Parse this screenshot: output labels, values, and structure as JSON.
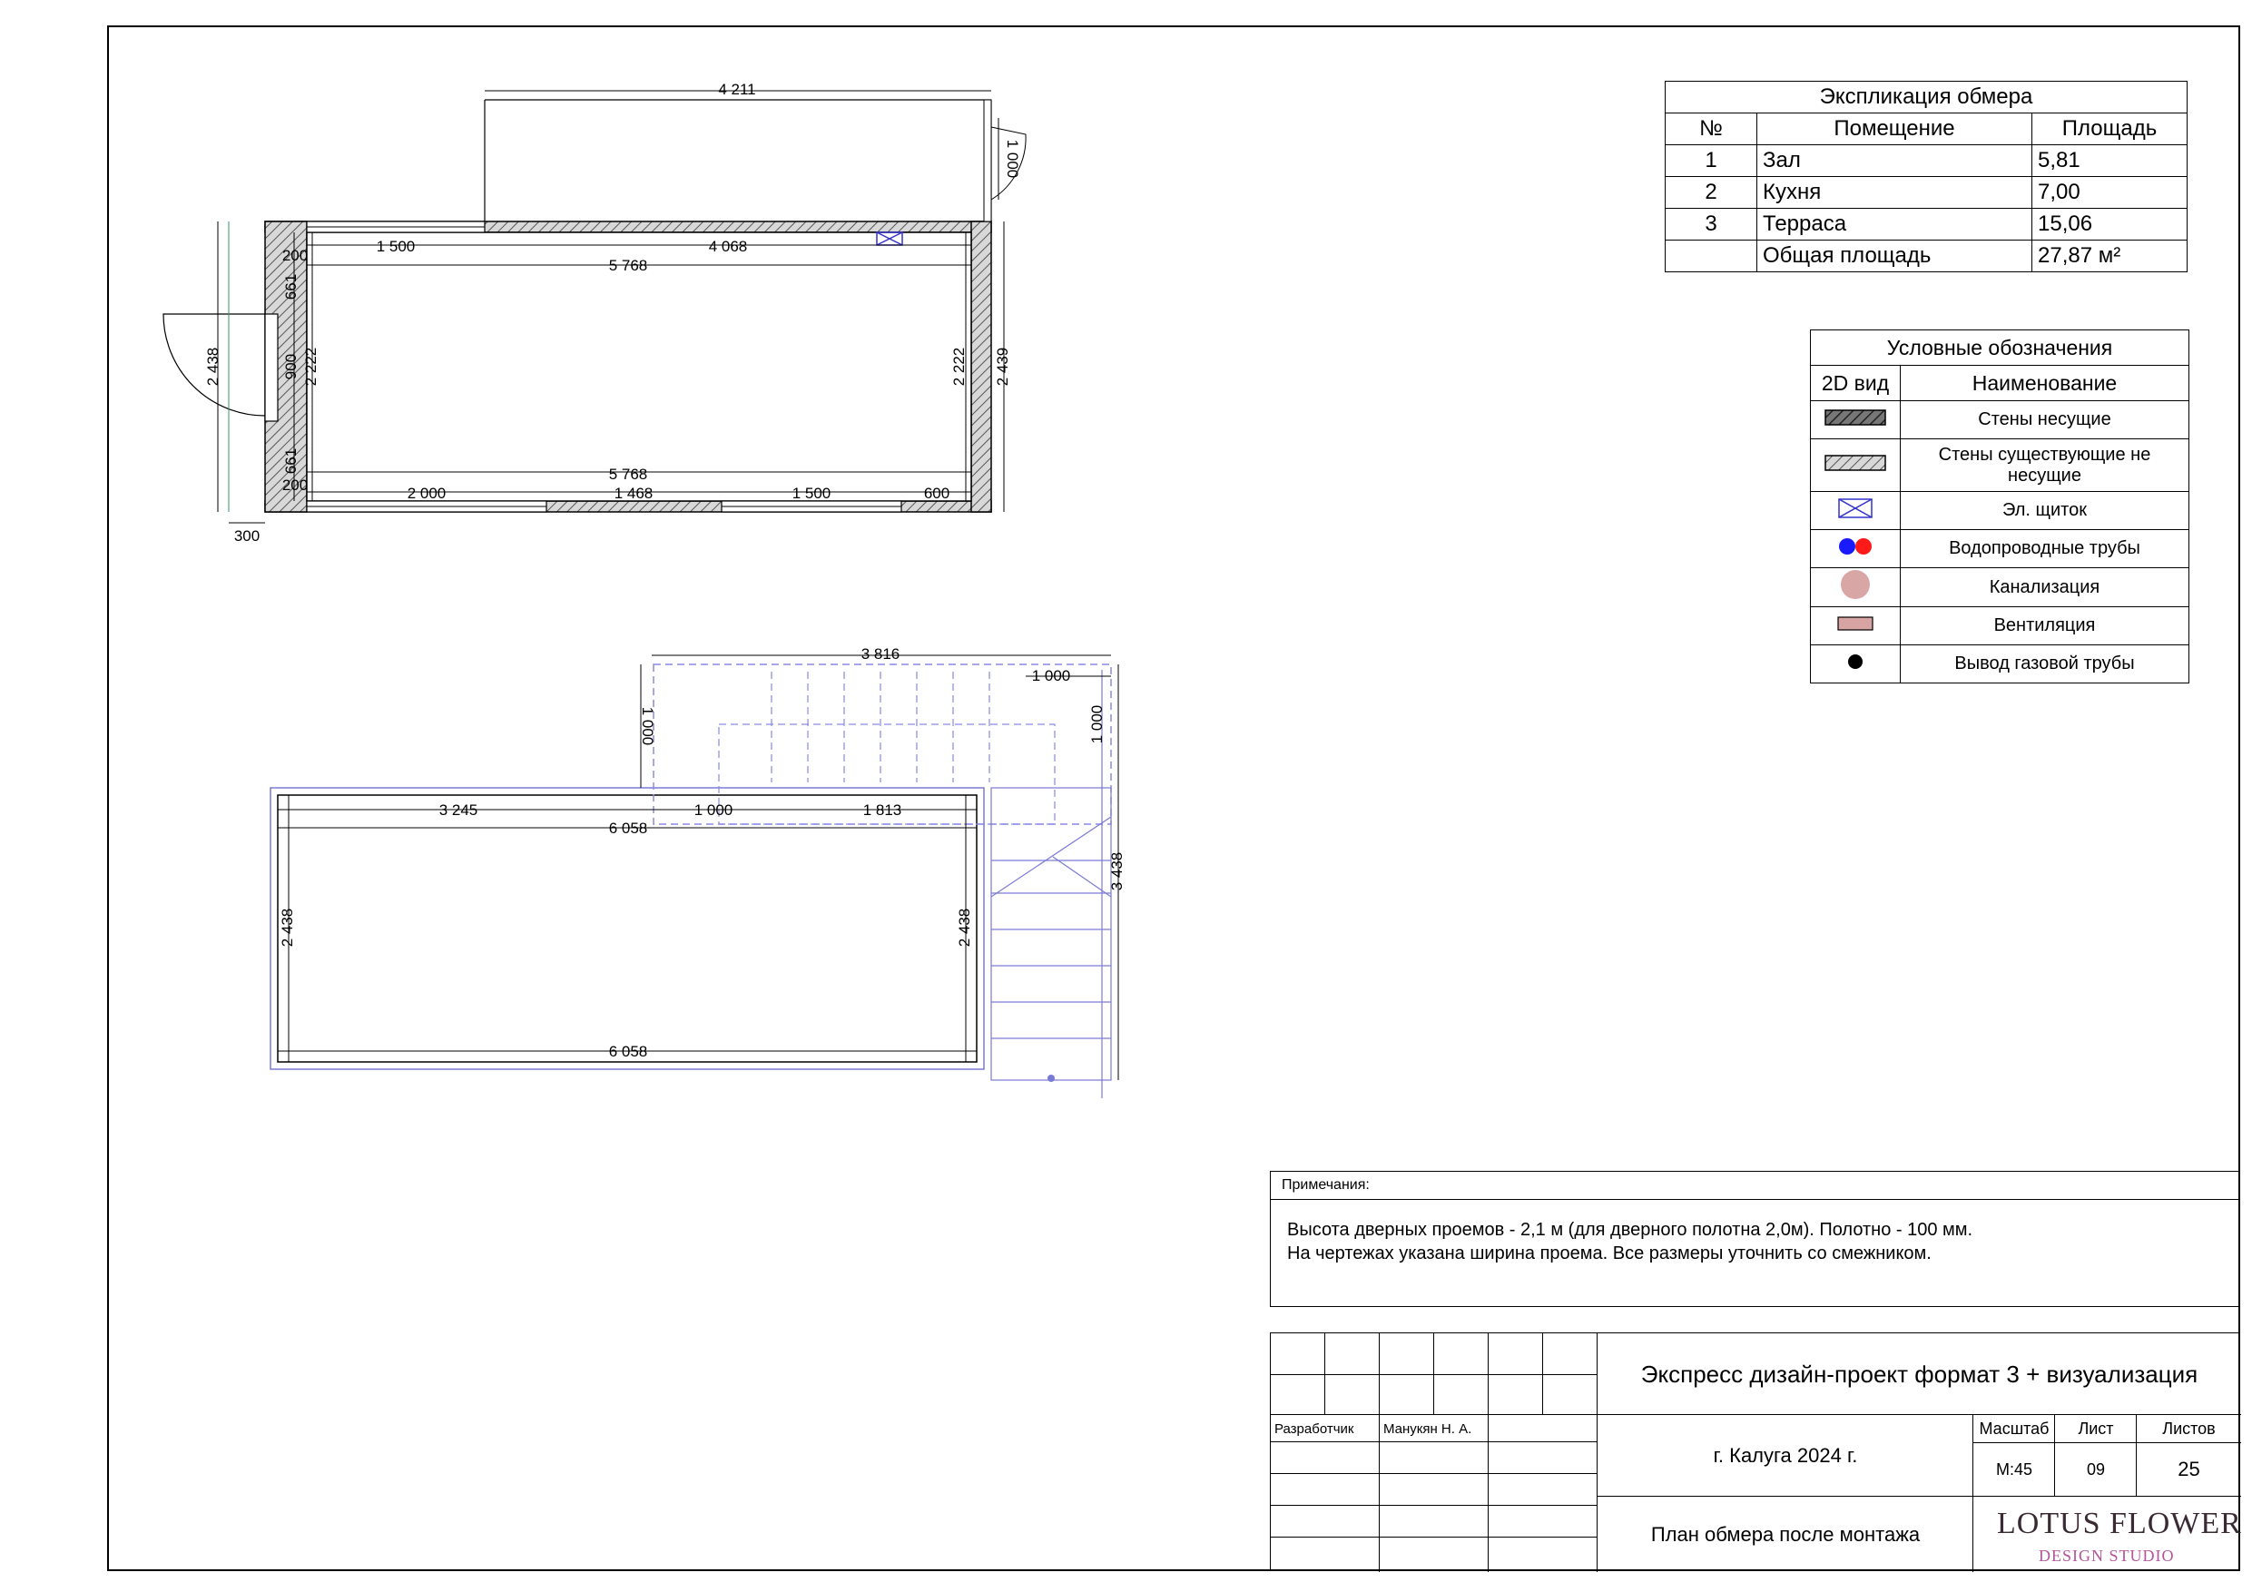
{
  "explication": {
    "title": "Экспликация обмера",
    "headers": [
      "№",
      "Помещение",
      "Площадь"
    ],
    "rows": [
      {
        "num": "1",
        "room": "Зал",
        "area": "5,81"
      },
      {
        "num": "2",
        "room": "Кухня",
        "area": "7,00"
      },
      {
        "num": "3",
        "room": "Терраса",
        "area": "15,06"
      }
    ],
    "total_label": "Общая площадь",
    "total_value": "27,87 м²"
  },
  "legend": {
    "title": "Условные обозначения",
    "col1": "2D вид",
    "col2": "Наименование",
    "items": [
      {
        "icon": "load-bearing-wall-icon",
        "label": "Стены несущие"
      },
      {
        "icon": "non-load-bearing-wall-icon",
        "label": "Стены существующие не несущие"
      },
      {
        "icon": "electrical-panel-icon",
        "label": "Эл. щиток"
      },
      {
        "icon": "water-pipes-icon",
        "label": "Водопроводные трубы"
      },
      {
        "icon": "sewer-icon",
        "label": "Канализация"
      },
      {
        "icon": "ventilation-icon",
        "label": "Вентиляция"
      },
      {
        "icon": "gas-pipe-icon",
        "label": "Вывод газовой трубы"
      }
    ],
    "colors": {
      "water_blue": "#1a1aff",
      "water_red": "#ff1a1a",
      "sewer": "#d9a6a6",
      "vent": "#d7a3a3"
    }
  },
  "plan1_dims": {
    "d4211": "4 211",
    "d1000": "1 000",
    "d1500a": "1 500",
    "d4068": "4 068",
    "d200a": "200",
    "d5768a": "5 768",
    "d661a": "661",
    "d900": "900",
    "d2222a": "2 222",
    "d2438": "2 438",
    "d2222b": "2 222",
    "d2439": "2 439",
    "d661b": "661",
    "d5768b": "5 768",
    "d200b": "200",
    "d2000": "2 000",
    "d1468": "1 468",
    "d1500b": "1 500",
    "d600": "600",
    "d300": "300"
  },
  "plan2_dims": {
    "d3816": "3 816",
    "d1000a": "1 000",
    "d1000b": "1 000",
    "d1000c": "1 000",
    "d1000d": "1 000",
    "d3245": "3 245",
    "d1813": "1 813",
    "d6058a": "6 058",
    "d2438a": "2 438",
    "d2438b": "2 438",
    "d3438": "3 438",
    "d6058b": "6 058"
  },
  "notes": {
    "header": "Примечания:",
    "line1": "Высота дверных проемов - 2,1 м (для дверного полотна 2,0м). Полотно - 100 мм.",
    "line2": "На чертежах указана ширина проема. Все размеры уточнить со смежником."
  },
  "titleblock": {
    "project": "Экспресс дизайн-проект формат 3 + визуализация",
    "developer_label": "Разработчик",
    "developer_name": "Манукян Н. А.",
    "city": "г. Калуга 2024 г.",
    "scale_label": "Масштаб",
    "sheet_label": "Лист",
    "sheets_label": "Листов",
    "scale": "М:45",
    "sheet": "09",
    "sheets": "25",
    "sheet_title": "План обмера после монтажа",
    "logo_main": "LOTUS FLOWER",
    "logo_sub": "DESIGN STUDIO"
  }
}
